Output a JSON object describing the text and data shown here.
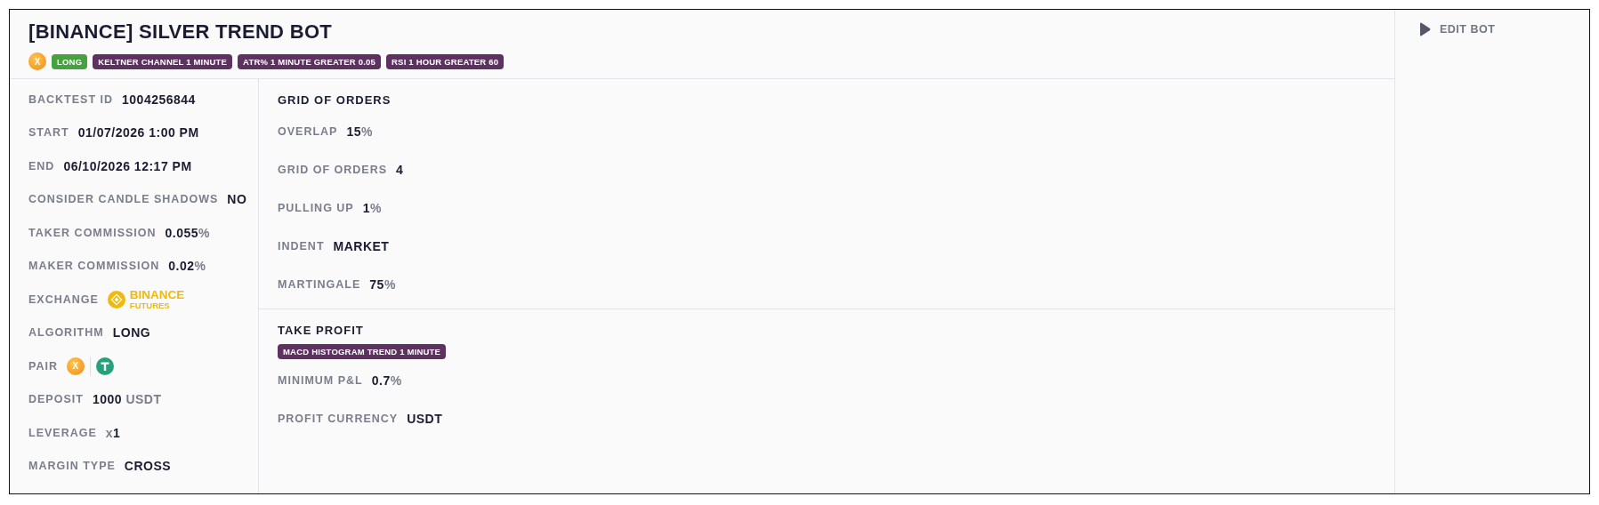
{
  "title": "[BINANCE] SILVER TREND BOT",
  "tags": [
    {
      "kind": "coin",
      "label": "X"
    },
    {
      "kind": "direction",
      "label": "LONG"
    },
    {
      "kind": "condition",
      "label": "KELTNER CHANNEL 1 MINUTE"
    },
    {
      "kind": "condition",
      "label": "ATR% 1 MINUTE GREATER 0.05"
    },
    {
      "kind": "condition",
      "label": "RSI 1 HOUR GREATER 60"
    }
  ],
  "details": [
    {
      "kind": "text",
      "label": "BACKTEST ID",
      "value": "1004256844"
    },
    {
      "kind": "text",
      "label": "START",
      "value": "01/07/2026 1:00 PM"
    },
    {
      "kind": "text",
      "label": "END",
      "value": "06/10/2026 12:17 PM"
    },
    {
      "kind": "text",
      "label": "CONSIDER CANDLE SHADOWS",
      "value": "NO"
    },
    {
      "kind": "text",
      "label": "TAKER COMMISSION",
      "value": "0.055",
      "suffix": "%"
    },
    {
      "kind": "text",
      "label": "MAKER COMMISSION",
      "value": "0.02",
      "suffix": "%"
    },
    {
      "kind": "exchange",
      "label": "EXCHANGE",
      "name": "BINANCE",
      "subtitle": "FUTURES"
    },
    {
      "kind": "text",
      "label": "ALGORITHM",
      "value": "LONG"
    },
    {
      "kind": "pair",
      "label": "PAIR",
      "base": "X"
    },
    {
      "kind": "text",
      "label": "DEPOSIT",
      "value": "1000",
      "suffix": "USDT"
    },
    {
      "kind": "text",
      "label": "LEVERAGE",
      "prefix": "x",
      "value": "1"
    },
    {
      "kind": "text",
      "label": "MARGIN TYPE",
      "value": "CROSS"
    }
  ],
  "sections": [
    {
      "title": "GRID OF ORDERS",
      "fields": [
        {
          "label": "OVERLAP",
          "value": "15",
          "suffix": "%"
        },
        {
          "label": "GRID OF ORDERS",
          "value": "4"
        },
        {
          "label": "PULLING UP",
          "value": "1",
          "suffix": "%"
        },
        {
          "label": "INDENT",
          "value": "MARKET"
        },
        {
          "label": "MARTINGALE",
          "value": "75",
          "suffix": "%"
        }
      ]
    },
    {
      "title": "TAKE PROFIT",
      "tags": [
        {
          "kind": "condition",
          "label": "MACD HISTOGRAM TREND 1 MINUTE"
        }
      ],
      "fields": [
        {
          "label": "MINIMUM P&L",
          "value": "0.7",
          "suffix": "%"
        },
        {
          "label": "PROFIT CURRENCY",
          "value": "USDT"
        }
      ]
    }
  ],
  "actions": [
    {
      "label": "EDIT BOT"
    }
  ]
}
